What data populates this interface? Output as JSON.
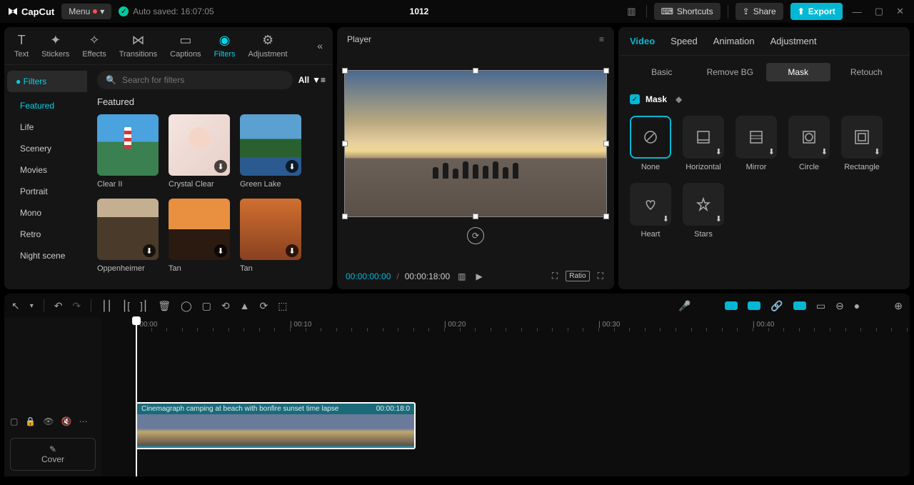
{
  "topbar": {
    "logo": "CapCut",
    "menu": "Menu",
    "autosave": "Auto saved: 16:07:05",
    "title": "1012",
    "shortcuts": "Shortcuts",
    "share": "Share",
    "export": "Export"
  },
  "leftTabs": [
    "Text",
    "Stickers",
    "Effects",
    "Transitions",
    "Captions",
    "Filters",
    "Adjustment"
  ],
  "sidebar": {
    "filters": "Filters",
    "cats": [
      "Featured",
      "Life",
      "Scenery",
      "Movies",
      "Portrait",
      "Mono",
      "Retro",
      "Night scene"
    ]
  },
  "search": {
    "placeholder": "Search for filters",
    "all": "All"
  },
  "section": "Featured",
  "thumbs": [
    {
      "label": "Clear II",
      "cls": "th-lighthouse",
      "dl": false
    },
    {
      "label": "Crystal Clear",
      "cls": "th-portrait",
      "dl": true
    },
    {
      "label": "Green Lake",
      "cls": "th-lake",
      "dl": true
    },
    {
      "label": "Oppenheimer",
      "cls": "th-opp",
      "dl": true
    },
    {
      "label": "Tan",
      "cls": "th-tan1",
      "dl": true
    },
    {
      "label": "Tan",
      "cls": "th-tan2",
      "dl": true
    }
  ],
  "player": {
    "title": "Player",
    "cur": "00:00:00:00",
    "total": "00:00:18:00",
    "ratio": "Ratio"
  },
  "inspector": {
    "tabs": [
      "Video",
      "Speed",
      "Animation",
      "Adjustment"
    ],
    "subtabs": [
      "Basic",
      "Remove BG",
      "Mask",
      "Retouch"
    ],
    "maskLabel": "Mask",
    "masks": [
      "None",
      "Horizontal",
      "Mirror",
      "Circle",
      "Rectangle",
      "Heart",
      "Stars"
    ]
  },
  "timeline": {
    "cover": "Cover",
    "marks": [
      "00:00",
      "00:10",
      "00:20",
      "00:30",
      "00:40"
    ],
    "clipName": "Cinemagraph camping at beach with bonfire sunset time lapse",
    "clipDur": "00:00:18:0"
  }
}
